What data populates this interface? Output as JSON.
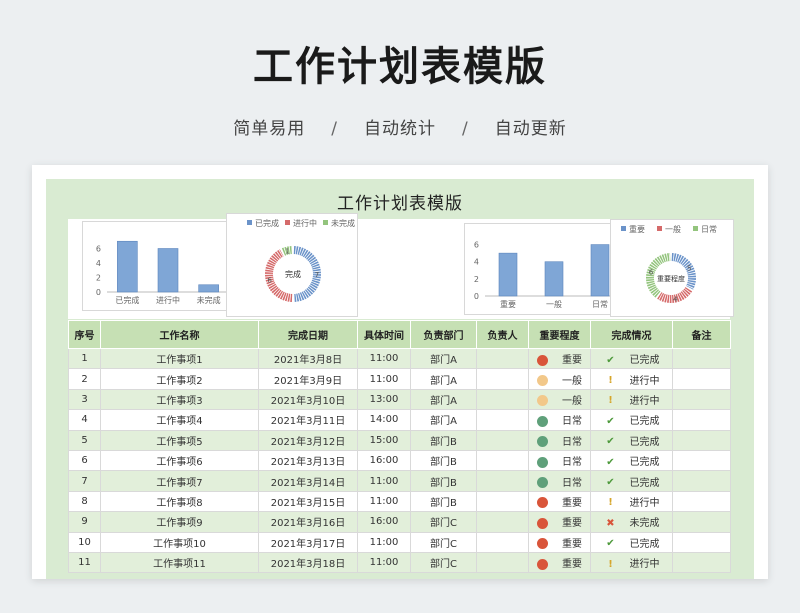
{
  "header": {
    "title": "工作计划表模版",
    "features": [
      "简单易用",
      "自动统计",
      "自动更新"
    ],
    "separator": "/"
  },
  "sheet": {
    "title": "工作计划表模版",
    "columns": [
      "序号",
      "工作名称",
      "完成日期",
      "具体时间",
      "负责部门",
      "负责人",
      "重要程度",
      "完成情况",
      "备注"
    ],
    "rows": [
      {
        "no": "1",
        "name": "工作事项1",
        "date": "2021年3月8日",
        "time": "11:00",
        "dept": "部门A",
        "owner": "",
        "priority": "重要",
        "status": "已完成"
      },
      {
        "no": "2",
        "name": "工作事项2",
        "date": "2021年3月9日",
        "time": "11:00",
        "dept": "部门A",
        "owner": "",
        "priority": "一般",
        "status": "进行中"
      },
      {
        "no": "3",
        "name": "工作事项3",
        "date": "2021年3月10日",
        "time": "13:00",
        "dept": "部门A",
        "owner": "",
        "priority": "一般",
        "status": "进行中"
      },
      {
        "no": "4",
        "name": "工作事项4",
        "date": "2021年3月11日",
        "time": "14:00",
        "dept": "部门A",
        "owner": "",
        "priority": "日常",
        "status": "已完成"
      },
      {
        "no": "5",
        "name": "工作事项5",
        "date": "2021年3月12日",
        "time": "15:00",
        "dept": "部门B",
        "owner": "",
        "priority": "日常",
        "status": "已完成"
      },
      {
        "no": "6",
        "name": "工作事项6",
        "date": "2021年3月13日",
        "time": "16:00",
        "dept": "部门B",
        "owner": "",
        "priority": "日常",
        "status": "已完成"
      },
      {
        "no": "7",
        "name": "工作事项7",
        "date": "2021年3月14日",
        "time": "11:00",
        "dept": "部门B",
        "owner": "",
        "priority": "日常",
        "status": "已完成"
      },
      {
        "no": "8",
        "name": "工作事项8",
        "date": "2021年3月15日",
        "time": "11:00",
        "dept": "部门B",
        "owner": "",
        "priority": "重要",
        "status": "进行中"
      },
      {
        "no": "9",
        "name": "工作事项9",
        "date": "2021年3月16日",
        "time": "16:00",
        "dept": "部门C",
        "owner": "",
        "priority": "重要",
        "status": "未完成"
      },
      {
        "no": "10",
        "name": "工作事项10",
        "date": "2021年3月17日",
        "time": "11:00",
        "dept": "部门C",
        "owner": "",
        "priority": "重要",
        "status": "已完成"
      },
      {
        "no": "11",
        "name": "工作事项11",
        "date": "2021年3月18日",
        "time": "11:00",
        "dept": "部门C",
        "owner": "",
        "priority": "重要",
        "status": "进行中"
      }
    ]
  },
  "colors": {
    "priority": {
      "重要": "#d9553a",
      "一般": "#f2c88a",
      "日常": "#5fa07a"
    },
    "status_icon": {
      "已完成": "check-icon",
      "进行中": "exclamation-icon",
      "未完成": "cross-icon"
    },
    "status_color": {
      "已完成": "#4e9a3c",
      "进行中": "#d6a62b",
      "未完成": "#d9553a"
    },
    "status_glyph": {
      "已完成": "✔",
      "进行中": "!",
      "未完成": "✖"
    }
  },
  "chart_data": [
    {
      "type": "bar",
      "categories": [
        "已完成",
        "进行中",
        "未完成"
      ],
      "values": [
        7,
        6,
        1
      ],
      "ylim": [
        0,
        8
      ],
      "yticks": [
        "0",
        "2",
        "4",
        "6"
      ]
    },
    {
      "type": "pie",
      "donut": true,
      "legend": [
        "已完成",
        "进行中",
        "未完成"
      ],
      "values": [
        7,
        6,
        1
      ],
      "labels": [
        "7",
        "6",
        "1"
      ],
      "center_label": "完成",
      "legend_position": "top"
    },
    {
      "type": "bar",
      "categories": [
        "重要",
        "一般",
        "日常"
      ],
      "values": [
        5,
        4,
        6
      ],
      "ylim": [
        0,
        7
      ],
      "yticks": [
        "0",
        "2",
        "4",
        "6"
      ]
    },
    {
      "type": "pie",
      "donut": true,
      "legend": [
        "重要",
        "一般",
        "日常"
      ],
      "values": [
        5,
        4,
        6
      ],
      "labels": [
        "5",
        "4",
        "6"
      ],
      "center_label": "重要程度",
      "legend_position": "top"
    }
  ]
}
